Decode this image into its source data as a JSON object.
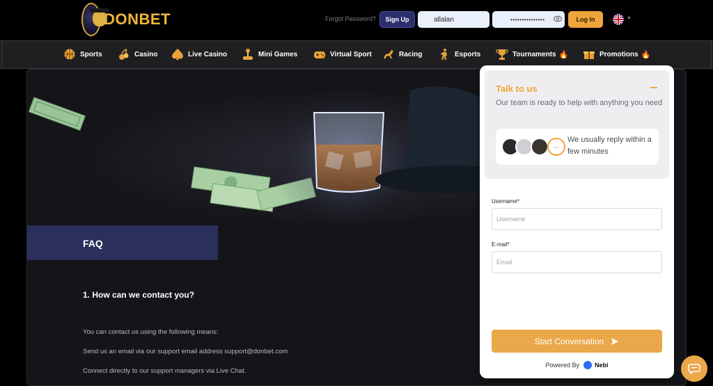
{
  "brand": {
    "name": "DONBET",
    "accent": "#f0a53a"
  },
  "header": {
    "forgot_password": "Forgot Password?",
    "signup_label": "Sign Up",
    "username_value": "allalan",
    "password_value": "•••••••••••••••",
    "login_label": "Log In",
    "language": "en-gb-flag"
  },
  "nav": {
    "items": [
      {
        "label": "Sports",
        "icon": "basketball-icon",
        "hot": false
      },
      {
        "label": "Casino",
        "icon": "cherry-icon",
        "hot": false
      },
      {
        "label": "Live Casino",
        "icon": "spade-icon",
        "hot": false
      },
      {
        "label": "Mini Games",
        "icon": "joystick-icon",
        "hot": false
      },
      {
        "label": "Virtual Sport",
        "icon": "gamepad-icon",
        "hot": false
      },
      {
        "label": "Racing",
        "icon": "horse-icon",
        "hot": false
      },
      {
        "label": "Esports",
        "icon": "soldier-icon",
        "hot": false
      },
      {
        "label": "Tournaments",
        "icon": "trophy-icon",
        "hot": true
      },
      {
        "label": "Promotions",
        "icon": "gift-icon",
        "hot": true
      }
    ]
  },
  "main": {
    "section_title": "FAQ",
    "question_1": "1. How can we contact you?",
    "paragraphs": [
      "You can contact us using the following means:",
      "Send us an email via our support email address support@donbet.com",
      "Connect directly to our support managers via Live Chat."
    ]
  },
  "chat": {
    "title": "Talk to us",
    "subtitle": "Our team is ready to help with anything you need",
    "reply_time": "We usually reply within a few minutes",
    "more_agents": "–",
    "username_label": "Username*",
    "username_placeholder": "Username",
    "email_label": "E-mail*",
    "email_placeholder": "Email",
    "start_label": "Start Conversation",
    "powered_by": "Powered By",
    "provider": "Nebi"
  }
}
